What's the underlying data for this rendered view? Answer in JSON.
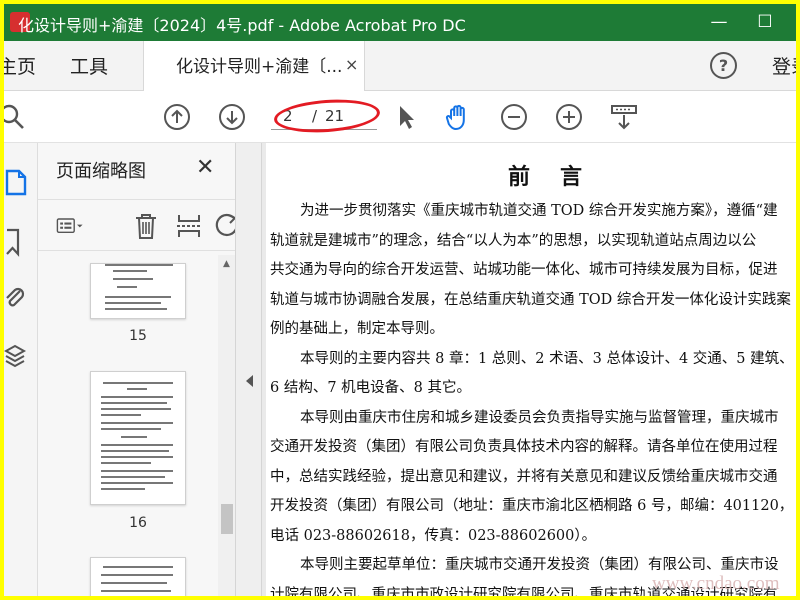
{
  "window": {
    "title": "化设计导则+渝建〔2024〕4号.pdf - Adobe Acrobat Pro DC",
    "minimize": "—",
    "maximize": "☐"
  },
  "tabs": {
    "home": "主页",
    "tools": "工具",
    "document_tab": "化设计导则+渝建〔...",
    "document_close": "×",
    "help": "?",
    "signin": "登录"
  },
  "toolbar": {
    "current_page": "2",
    "page_separator": "/",
    "total_pages": "21",
    "highlight_color": "#e31b23"
  },
  "thumbnails_panel": {
    "title": "页面缩略图",
    "close": "✕",
    "thumbs": [
      {
        "page": "15"
      },
      {
        "page": "16"
      }
    ]
  },
  "document": {
    "heading": "前言",
    "lines": [
      {
        "text": "为进一步贯彻落实《重庆城市轨道交通 TOD 综合开发实施方案》，遵循“建",
        "indent": true
      },
      {
        "text": "轨道就是建城市”的理念，结合“以人为本”的思想，以实现轨道站点周边以公",
        "indent": false
      },
      {
        "text": "共交通为导向的综合开发运营、站城功能一体化、城市可持续发展为目标，促进",
        "indent": false
      },
      {
        "text": "轨道与城市协调融合发展，在总结重庆轨道交通 TOD 综合开发一体化设计实践案",
        "indent": false
      },
      {
        "text": "例的基础上，制定本导则。",
        "indent": false
      },
      {
        "text": "本导则的主要内容共 8 章：1 总则、2 术语、3 总体设计、4 交通、5 建筑、",
        "indent": true
      },
      {
        "text": "6 结构、7 机电设备、8 其它。",
        "indent": false
      },
      {
        "text": "本导则由重庆市住房和城乡建设委员会负责指导实施与监督管理，重庆城市",
        "indent": true
      },
      {
        "text": "交通开发投资（集团）有限公司负责具体技术内容的解释。请各单位在使用过程",
        "indent": false
      },
      {
        "text": "中，总结实践经验，提出意见和建议，并将有关意见和建议反馈给重庆城市交通",
        "indent": false
      },
      {
        "text": "开发投资（集团）有限公司（地址：重庆市渝北区栖桐路 6 号，邮编：401120，",
        "indent": false
      },
      {
        "text": "电话 023-88602618，传真：023-88602600）。",
        "indent": false
      },
      {
        "text": "本导则主要起草单位：重庆城市交通开发投资（集团）有限公司、重庆市设",
        "indent": true
      },
      {
        "text": "计院有限公司、重庆市市政设计研究院有限公司、重庆市轨道交通设计研究院有",
        "indent": false
      }
    ]
  },
  "watermark": {
    "text": "www.cndao.com",
    "tagline": "学兜网"
  },
  "colors": {
    "titlebar": "#1e7b36",
    "accent_blue": "#1473e6",
    "frame": "#ffff00"
  }
}
